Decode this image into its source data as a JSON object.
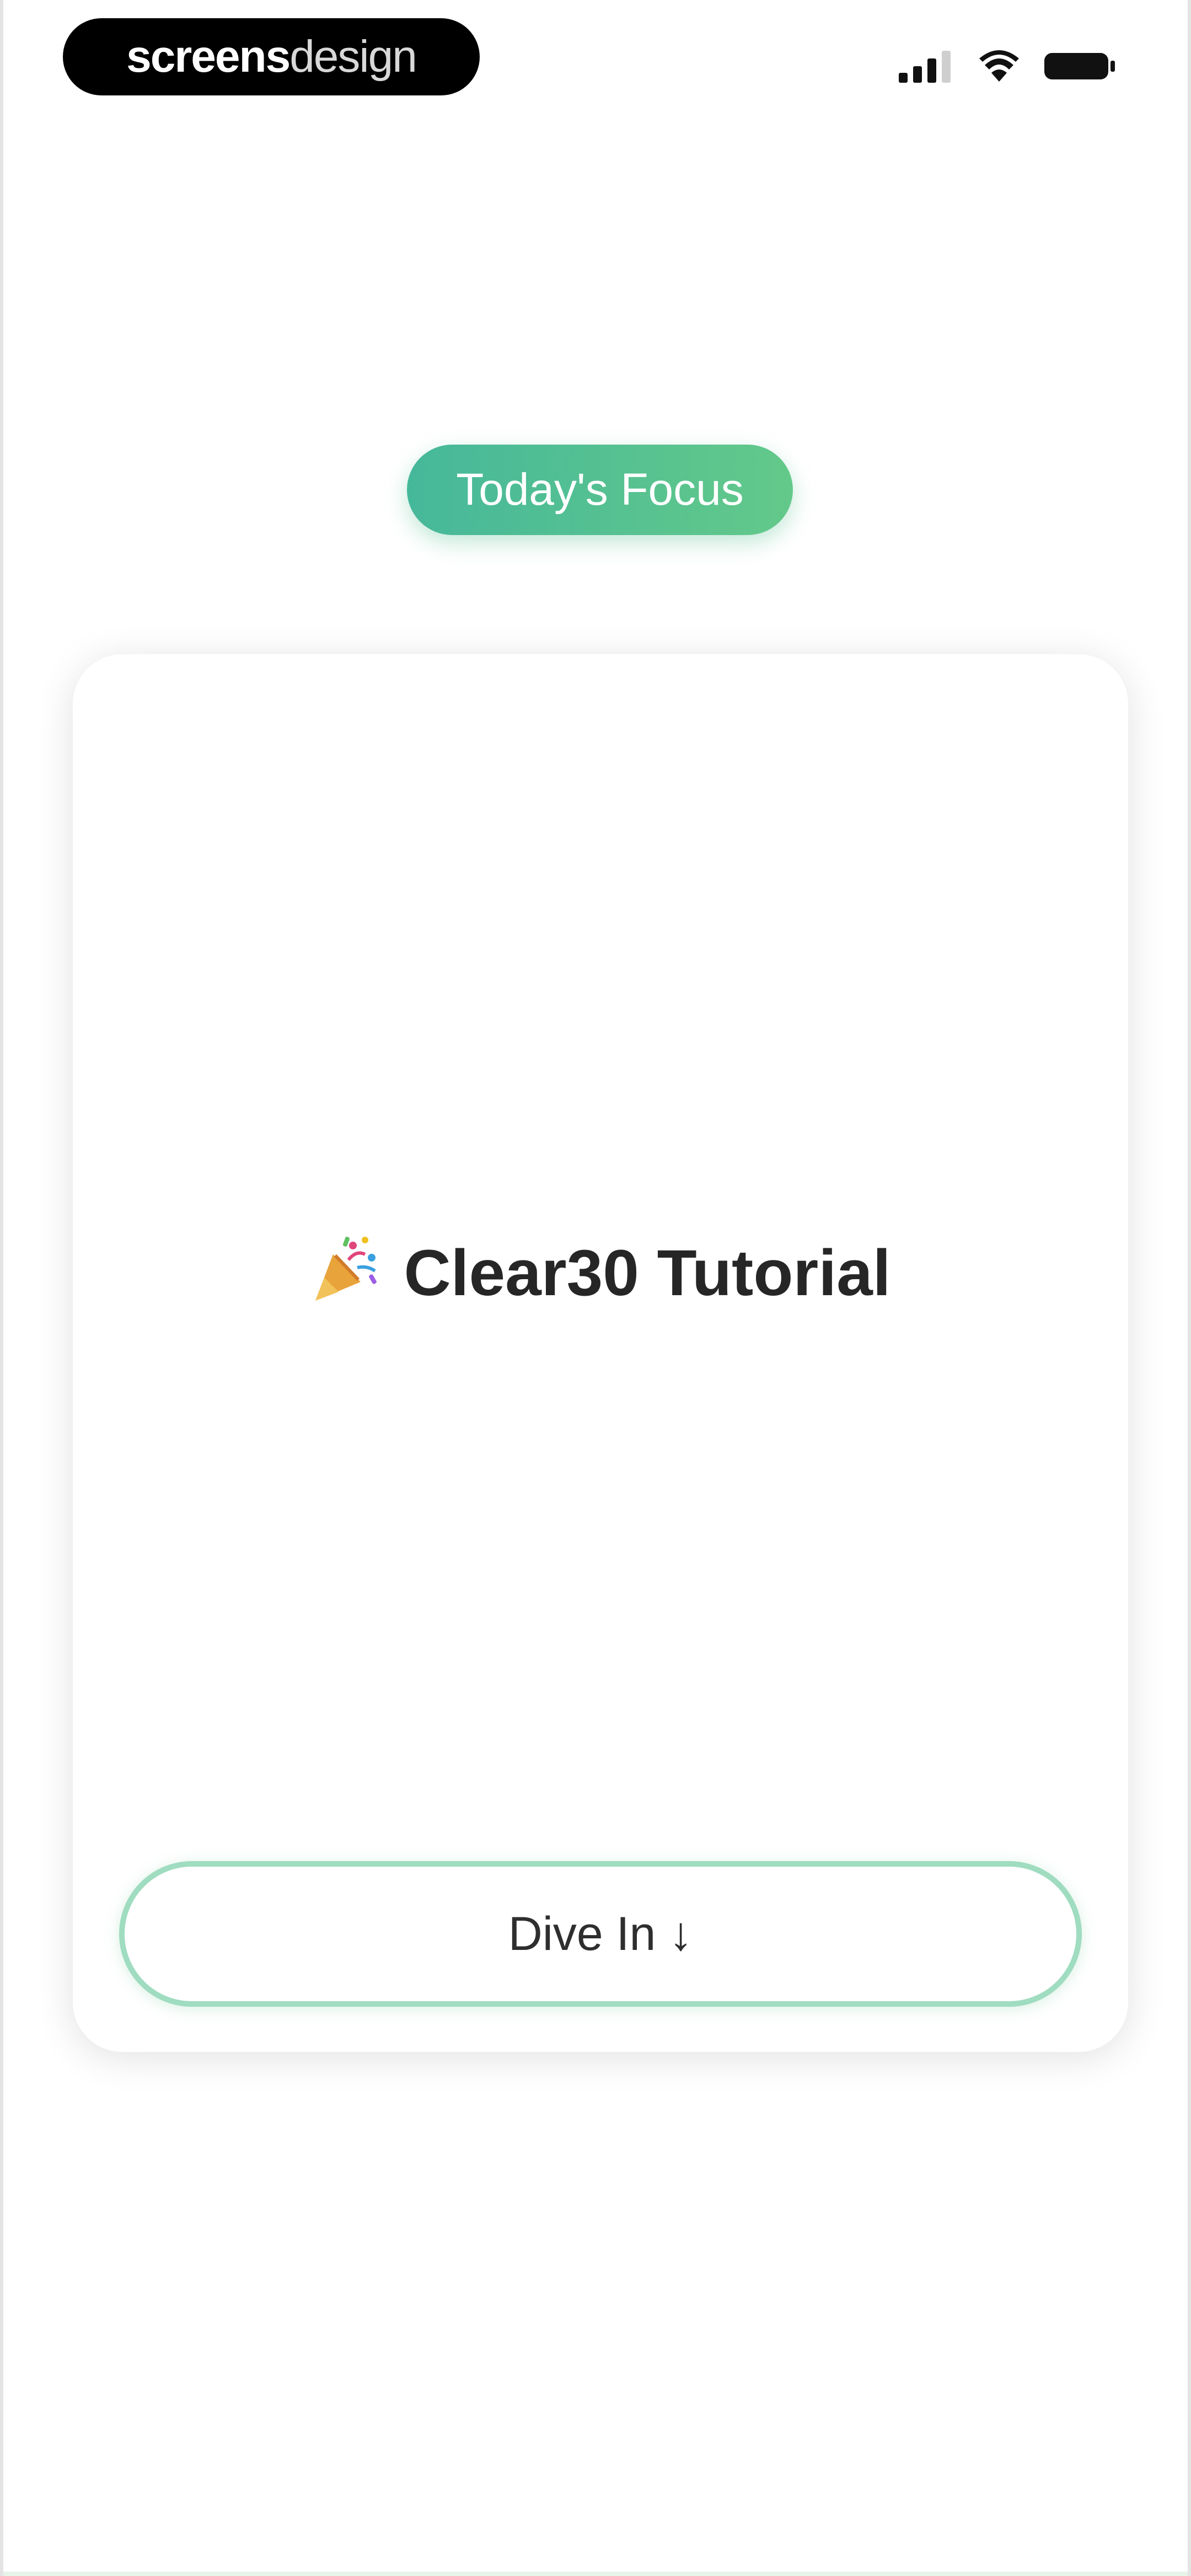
{
  "status_bar": {
    "brand_strong": "screens",
    "brand_light": "design",
    "icons": [
      "cellular-signal-icon",
      "wifi-icon",
      "battery-icon"
    ]
  },
  "focus": {
    "label": "Today's Focus",
    "gradient_start": "#46b89a",
    "gradient_end": "#63c98a"
  },
  "card": {
    "title_emoji_icon": "party-popper-icon",
    "title": "Clear30 Tutorial",
    "button_label": "Dive In ↓",
    "button_border_color": "#9fdcc0"
  }
}
